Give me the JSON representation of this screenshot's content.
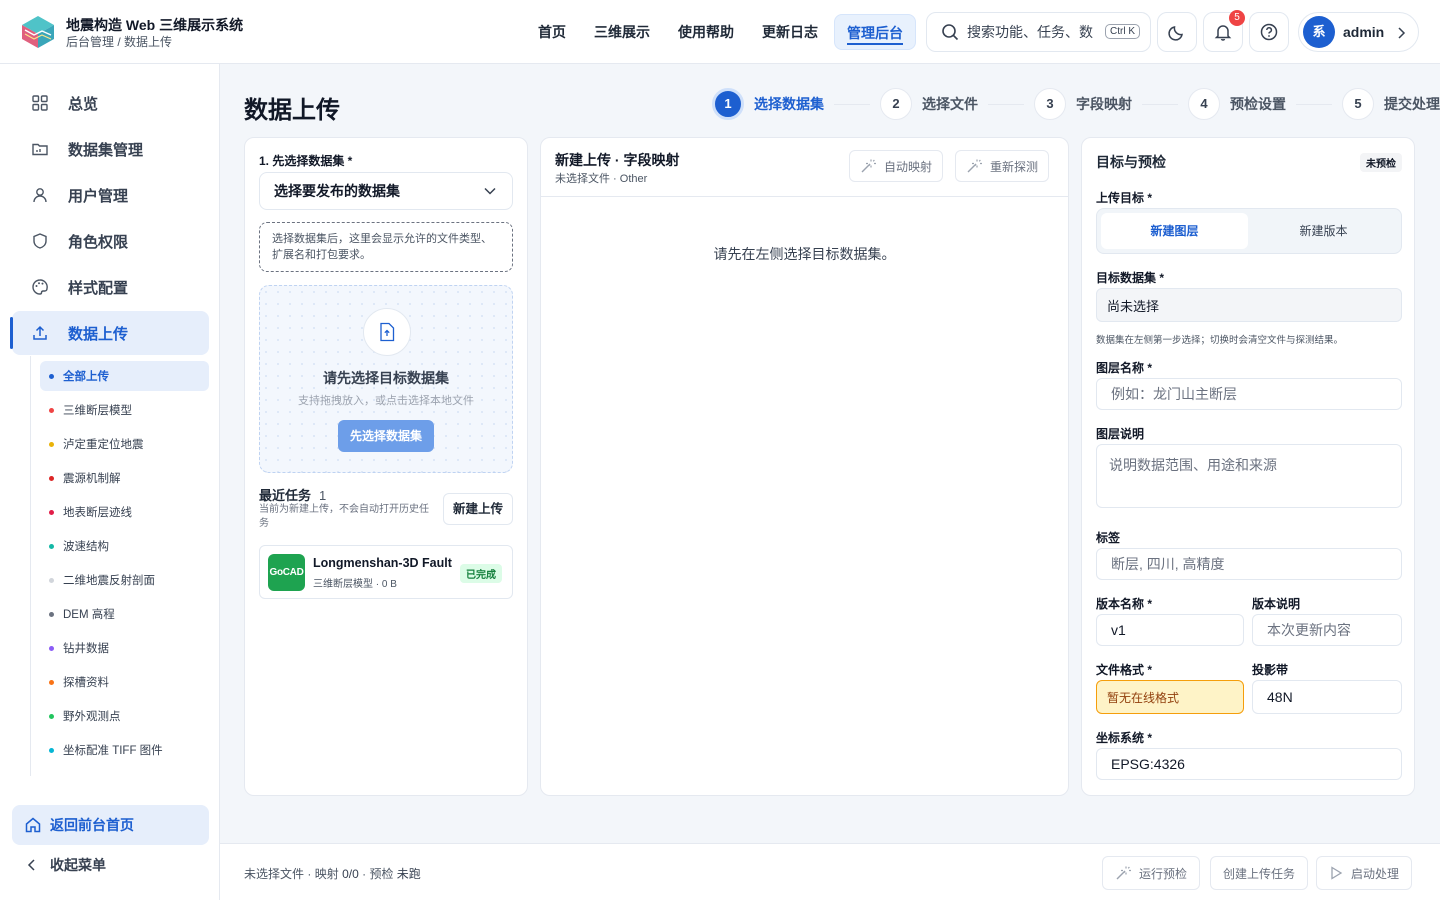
{
  "header": {
    "title": "地震构造 Web 三维展示系统",
    "breadcrumb": "后台管理 / 数据上传",
    "nav": [
      "首页",
      "三维展示",
      "使用帮助",
      "更新日志",
      "管理后台"
    ],
    "active_nav": "管理后台",
    "search_placeholder": "搜索功能、任务、数",
    "search_shortcut": "Ctrl K",
    "notification_count": "5",
    "user_initial": "系",
    "username": "admin"
  },
  "sidebar": {
    "items": [
      {
        "label": "总览",
        "icon": "grid-icon"
      },
      {
        "label": "数据集管理",
        "icon": "folder-icon"
      },
      {
        "label": "用户管理",
        "icon": "user-icon"
      },
      {
        "label": "角色权限",
        "icon": "shield-icon"
      },
      {
        "label": "样式配置",
        "icon": "palette-icon"
      },
      {
        "label": "数据上传",
        "icon": "upload-icon"
      }
    ],
    "active_item": "数据上传",
    "sub_items": [
      {
        "label": "全部上传",
        "color": "#1d5fd0"
      },
      {
        "label": "三维断层模型",
        "color": "#ef4444"
      },
      {
        "label": "泸定重定位地震",
        "color": "#eab308"
      },
      {
        "label": "震源机制解",
        "color": "#dc2626"
      },
      {
        "label": "地表断层迹线",
        "color": "#e11d48"
      },
      {
        "label": "波速结构",
        "color": "#14b8a6"
      },
      {
        "label": "二维地震反射剖面",
        "color": "#d1d5db"
      },
      {
        "label": "DEM 高程",
        "color": "#6b7280"
      },
      {
        "label": "钻井数据",
        "color": "#8b5cf6"
      },
      {
        "label": "探槽资料",
        "color": "#f97316"
      },
      {
        "label": "野外观测点",
        "color": "#22c55e"
      },
      {
        "label": "坐标配准 TIFF 图件",
        "color": "#06b6d4"
      }
    ],
    "active_sub": "全部上传",
    "back_home": "返回前台首页",
    "collapse": "收起菜单"
  },
  "page": {
    "title": "数据上传",
    "steps": [
      "选择数据集",
      "选择文件",
      "字段映射",
      "预检设置",
      "提交处理"
    ],
    "active_step": 1
  },
  "left_panel": {
    "select_label": "1. 先选择数据集 *",
    "select_value": "选择要发布的数据集",
    "hint": "选择数据集后，这里会显示允许的文件类型、扩展名和打包要求。",
    "drop_title": "请先选择目标数据集",
    "drop_sub": "支持拖拽放入，或点击选择本地文件",
    "drop_button": "先选择数据集",
    "recent_title": "最近任务",
    "recent_count": "1",
    "recent_sub": "当前为新建上传，不会自动打开历史任务",
    "new_upload": "新建上传",
    "task": {
      "icon_text": "GoCAD",
      "name": "Longmenshan-3D Fault",
      "meta": "三维断层模型 · 0 B",
      "status": "已完成"
    }
  },
  "middle_panel": {
    "title": "新建上传 · 字段映射",
    "subtitle": "未选择文件 · Other",
    "auto_map": "自动映射",
    "redetect": "重新探测",
    "empty": "请先在左侧选择目标数据集。"
  },
  "right_panel": {
    "title": "目标与预检",
    "badge": "未预检",
    "target_label": "上传目标 *",
    "target_options": [
      "新建图层",
      "新建版本"
    ],
    "target_active": "新建图层",
    "dataset_label": "目标数据集 *",
    "dataset_value": "尚未选择",
    "dataset_note": "数据集在左侧第一步选择；切换时会清空文件与探测结果。",
    "layer_name_label": "图层名称 *",
    "layer_name_placeholder": "例如：龙门山主断层",
    "layer_desc_label": "图层说明",
    "layer_desc_placeholder": "说明数据范围、用途和来源",
    "tags_label": "标签",
    "tags_placeholder": "断层, 四川, 高精度",
    "version_name_label": "版本名称 *",
    "version_name_value": "v1",
    "version_desc_label": "版本说明",
    "version_desc_placeholder": "本次更新内容",
    "format_label": "文件格式 *",
    "format_value": "暂无在线格式",
    "zone_label": "投影带",
    "zone_value": "48N",
    "crs_label": "坐标系统 *",
    "crs_value": "EPSG:4326"
  },
  "footer": {
    "status_file": "未选择文件",
    "status_mapping_label": "映射",
    "status_mapping": "0/0",
    "status_precheck_label": "预检",
    "status_precheck": "未跑",
    "run_precheck": "运行预检",
    "create_task": "创建上传任务",
    "start_process": "启动处理"
  },
  "colors": {
    "accent": "#1d5fd0",
    "success": "#1ea350",
    "warning": "#f59e0b",
    "danger": "#ef4444"
  }
}
